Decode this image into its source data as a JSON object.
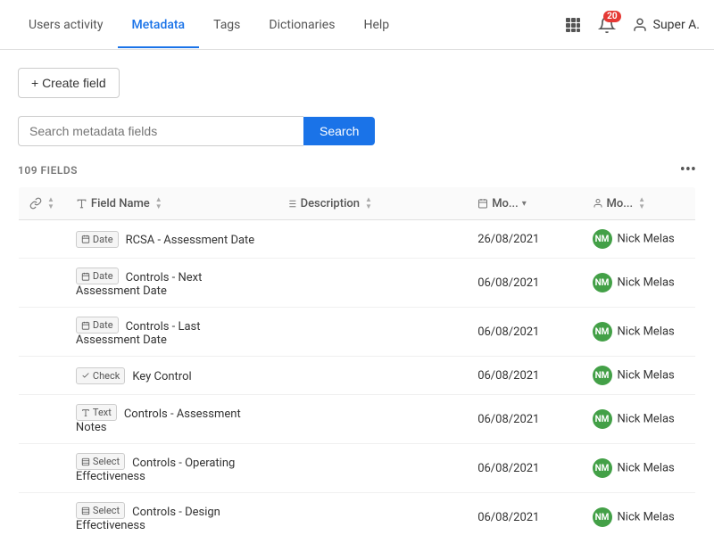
{
  "header": {
    "title": "Users activity",
    "nav": [
      {
        "label": "Users activity",
        "active": false,
        "id": "users-activity"
      },
      {
        "label": "Metadata",
        "active": true,
        "id": "metadata"
      },
      {
        "label": "Tags",
        "active": false,
        "id": "tags"
      },
      {
        "label": "Dictionaries",
        "active": false,
        "id": "dictionaries"
      },
      {
        "label": "Help",
        "active": false,
        "id": "help"
      }
    ],
    "notifications_count": "20",
    "user_name": "Super A."
  },
  "toolbar": {
    "create_field_label": "+ Create field"
  },
  "search": {
    "placeholder": "Search metadata fields",
    "button_label": "Search"
  },
  "fields_section": {
    "count_label": "109 FIELDS",
    "more_icon": "•••"
  },
  "table": {
    "columns": [
      {
        "id": "link",
        "label": "",
        "icon": "link-icon"
      },
      {
        "id": "field_name",
        "label": "Field Name",
        "icon": "text-icon",
        "sortable": true
      },
      {
        "id": "description",
        "label": "Description",
        "icon": "list-icon",
        "sortable": true
      },
      {
        "id": "modified_date",
        "label": "Mo...",
        "icon": "calendar-icon",
        "sortable": true,
        "has_dropdown": true
      },
      {
        "id": "modified_by",
        "label": "Mo...",
        "icon": "user-icon",
        "sortable": true
      }
    ],
    "rows": [
      {
        "type": "Date",
        "type_icon": "calendar-icon",
        "field_name": "RCSA - Assessment Date",
        "description": "",
        "modified_date": "26/08/2021",
        "modified_by": "Nick Melas",
        "avatar_initials": "NM",
        "avatar_color": "#43a047"
      },
      {
        "type": "Date",
        "type_icon": "calendar-icon",
        "field_name": "Controls - Next Assessment Date",
        "description": "",
        "modified_date": "06/08/2021",
        "modified_by": "Nick Melas",
        "avatar_initials": "NM",
        "avatar_color": "#43a047"
      },
      {
        "type": "Date",
        "type_icon": "calendar-icon",
        "field_name": "Controls - Last Assessment Date",
        "description": "",
        "modified_date": "06/08/2021",
        "modified_by": "Nick Melas",
        "avatar_initials": "NM",
        "avatar_color": "#43a047"
      },
      {
        "type": "Check",
        "type_icon": "check-icon",
        "field_name": "Key Control",
        "description": "",
        "modified_date": "06/08/2021",
        "modified_by": "Nick Melas",
        "avatar_initials": "NM",
        "avatar_color": "#43a047"
      },
      {
        "type": "Text",
        "type_icon": "text-icon",
        "field_name": "Controls - Assessment Notes",
        "description": "",
        "modified_date": "06/08/2021",
        "modified_by": "Nick Melas",
        "avatar_initials": "NM",
        "avatar_color": "#43a047"
      },
      {
        "type": "Select",
        "type_icon": "select-icon",
        "field_name": "Controls - Operating Effectiveness",
        "description": "",
        "modified_date": "06/08/2021",
        "modified_by": "Nick Melas",
        "avatar_initials": "NM",
        "avatar_color": "#43a047"
      },
      {
        "type": "Select",
        "type_icon": "select-icon",
        "field_name": "Controls - Design Effectiveness",
        "description": "",
        "modified_date": "06/08/2021",
        "modified_by": "Nick Melas",
        "avatar_initials": "NM",
        "avatar_color": "#43a047"
      }
    ]
  }
}
